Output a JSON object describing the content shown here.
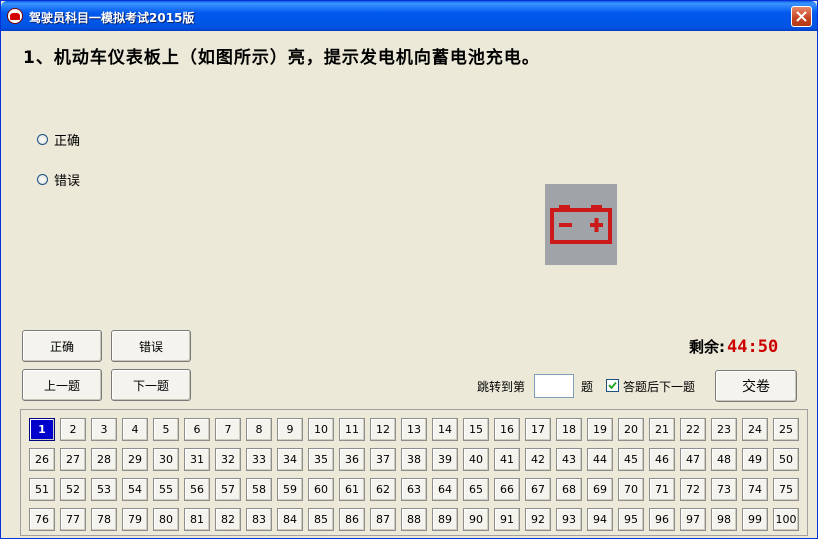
{
  "window": {
    "title": "驾驶员科目一模拟考试2015版"
  },
  "question": {
    "text": "1、机动车仪表板上（如图所示）亮，提示发电机向蓄电池充电。"
  },
  "options": [
    {
      "label": "正确"
    },
    {
      "label": "错误"
    }
  ],
  "image": {
    "icon": "battery-warning-icon",
    "background": "#a0a4a8",
    "color": "#cc1a1a"
  },
  "buttons": {
    "correct": "正确",
    "wrong": "错误",
    "prev": "上一题",
    "next": "下一题",
    "submit": "交卷"
  },
  "timer": {
    "label": "剩余:",
    "value": "44:50"
  },
  "jump": {
    "prefix": "跳转到第",
    "suffix": "题",
    "value": ""
  },
  "auto_next": {
    "label": "答题后下一题",
    "checked": true
  },
  "navigator": {
    "current": 1,
    "total": 100
  }
}
